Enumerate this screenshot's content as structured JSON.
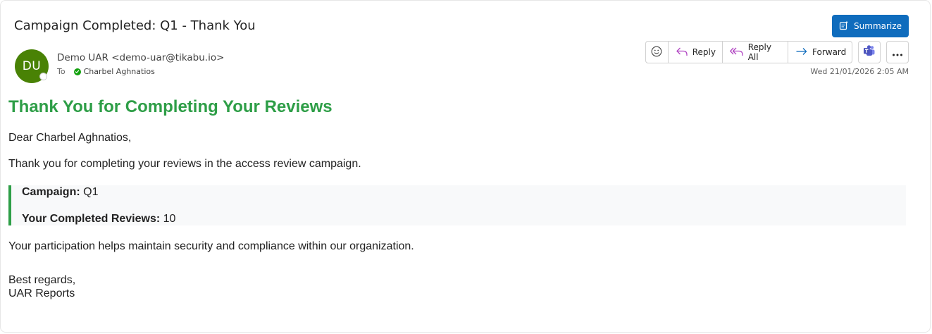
{
  "email": {
    "subject": "Campaign Completed: Q1 - Thank You",
    "summarize_label": "Summarize",
    "sender": {
      "initials": "DU",
      "display": "Demo UAR <demo-uar@tikabu.io>"
    },
    "to_label": "To",
    "recipient": "Charbel Aghnatios",
    "timestamp": "Wed 21/01/2026 2:05 AM",
    "colors": {
      "avatar": "#498205",
      "accent_blue": "#0f6cbd",
      "heading_green": "#2e9e47"
    }
  },
  "toolbar": {
    "emoji_icon": "smiley-icon",
    "reply_label": "Reply",
    "reply_all_label": "Reply All",
    "forward_label": "Forward",
    "teams_icon": "teams-icon",
    "more_icon": "more-icon"
  },
  "body": {
    "heading": "Thank You for Completing Your Reviews",
    "greeting": "Dear Charbel Aghnatios,",
    "intro": "Thank you for completing your reviews in the access review campaign.",
    "campaign_label": "Campaign:",
    "campaign_value": "Q1",
    "completed_label": "Your Completed Reviews:",
    "completed_value": "10",
    "participation": "Your participation helps maintain security and compliance within our organization.",
    "closing": "Best regards,",
    "signature": "UAR Reports"
  }
}
